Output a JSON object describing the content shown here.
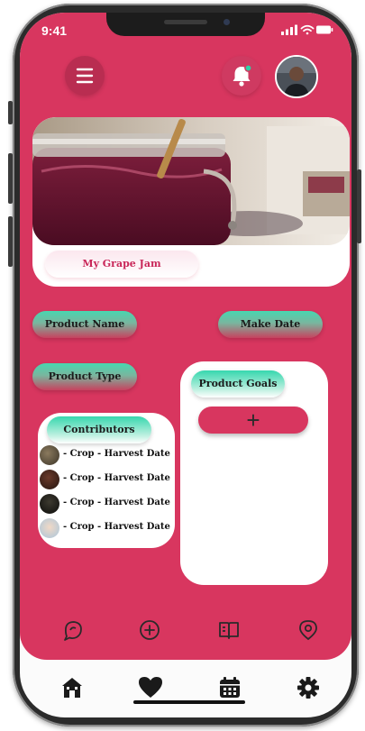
{
  "status_bar": {
    "time": "9:41"
  },
  "header": {
    "menu_icon": "hamburger-menu-icon",
    "notification_icon": "bell-icon",
    "notification_dot_color": "#2ed1a5",
    "avatar": "user-avatar"
  },
  "product": {
    "title": "My Grape Jam",
    "image": "grape-jam-jar-photo"
  },
  "fields": {
    "product_name": "Product Name",
    "make_date": "Make Date",
    "product_type": "Product Type"
  },
  "contributors": {
    "title": "Contributors",
    "rows": [
      {
        "text": "- Crop - Harvest Date"
      },
      {
        "text": "- Crop - Harvest Date"
      },
      {
        "text": "- Crop - Harvest Date"
      },
      {
        "text": "- Crop - Harvest Date"
      }
    ]
  },
  "goals": {
    "title": "Product Goals",
    "add_label": "+"
  },
  "action_bar": [
    "chat-bubble-icon",
    "add-circle-icon",
    "open-book-icon",
    "location-pin-icon"
  ],
  "tab_bar": [
    "home-icon",
    "heart-icon",
    "calendar-icon",
    "gear-icon"
  ],
  "colors": {
    "primary": "#d8365f",
    "accent_teal": "#3fd5ab",
    "card": "#ffffff"
  }
}
